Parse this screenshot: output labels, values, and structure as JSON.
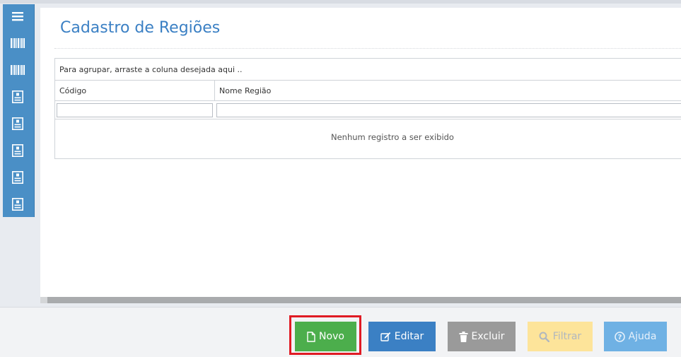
{
  "page": {
    "title": "Cadastro de Regiões"
  },
  "sidebar": {
    "items": [
      {
        "icon": "menu-icon"
      },
      {
        "icon": "barcode-icon"
      },
      {
        "icon": "barcode-icon"
      },
      {
        "icon": "document-icon"
      },
      {
        "icon": "document-icon"
      },
      {
        "icon": "document-icon"
      },
      {
        "icon": "document-icon"
      },
      {
        "icon": "document-icon"
      }
    ]
  },
  "grid": {
    "group_hint": "Para agrupar, arraste a coluna desejada aqui ..",
    "columns": [
      "Código",
      "Nome Região"
    ],
    "filters": [
      "",
      ""
    ],
    "empty_message": "Nenhum registro a ser exibido"
  },
  "footer": {
    "buttons": {
      "novo": "Novo",
      "editar": "Editar",
      "excluir": "Excluir",
      "filtrar": "Filtrar",
      "ajuda": "Ajuda"
    }
  },
  "colors": {
    "sidebar": "#4a8fc6",
    "title": "#3b80c4",
    "novo": "#4cae4c",
    "editar": "#3b80c4",
    "excluir": "#9a9a9a",
    "filtrar": "#fde49a",
    "ajuda": "#6fb1e4",
    "highlight": "#e01b24"
  }
}
